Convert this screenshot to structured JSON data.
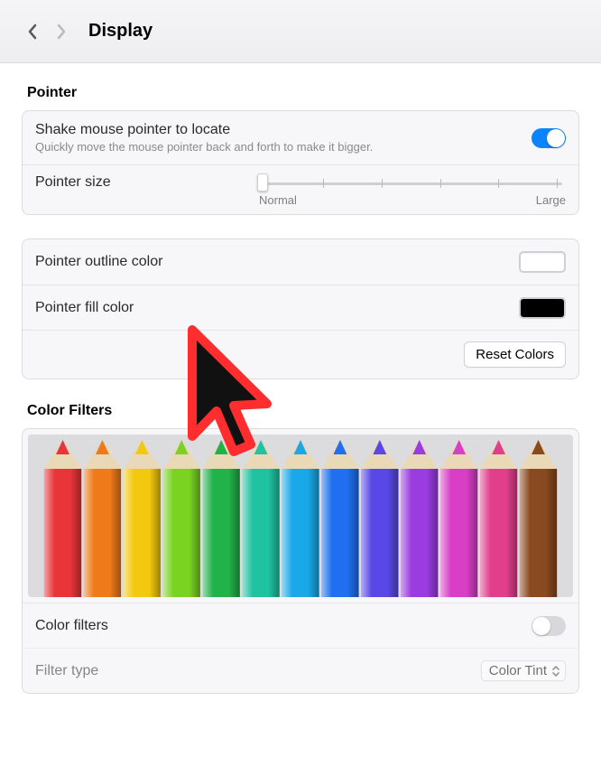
{
  "header": {
    "title": "Display"
  },
  "pointer_section": {
    "heading": "Pointer",
    "shake": {
      "title": "Shake mouse pointer to locate",
      "subtitle": "Quickly move the mouse pointer back and forth to make it bigger.",
      "enabled": true
    },
    "size": {
      "label": "Pointer size",
      "min_label": "Normal",
      "max_label": "Large",
      "value_pct": 0,
      "tick_count": 6
    },
    "outline": {
      "label": "Pointer outline color",
      "color": "#ffffff"
    },
    "fill": {
      "label": "Pointer fill color",
      "color": "#000000"
    },
    "reset_label": "Reset Colors",
    "preview_cursor": {
      "outline": "#ff2d2d",
      "fill": "#111111"
    }
  },
  "filters_section": {
    "heading": "Color Filters",
    "enabled": false,
    "toggle_label": "Color filters",
    "type_label": "Filter type",
    "type_value": "Color Tint",
    "pencil_colors": [
      "#e8353a",
      "#ef7a1a",
      "#f3c90f",
      "#7bd321",
      "#22b24a",
      "#1fc3a1",
      "#1aa8e8",
      "#1f6ff0",
      "#5a48e6",
      "#9a3de0",
      "#d93fc6",
      "#e13f8c",
      "#8a4a1f"
    ]
  }
}
